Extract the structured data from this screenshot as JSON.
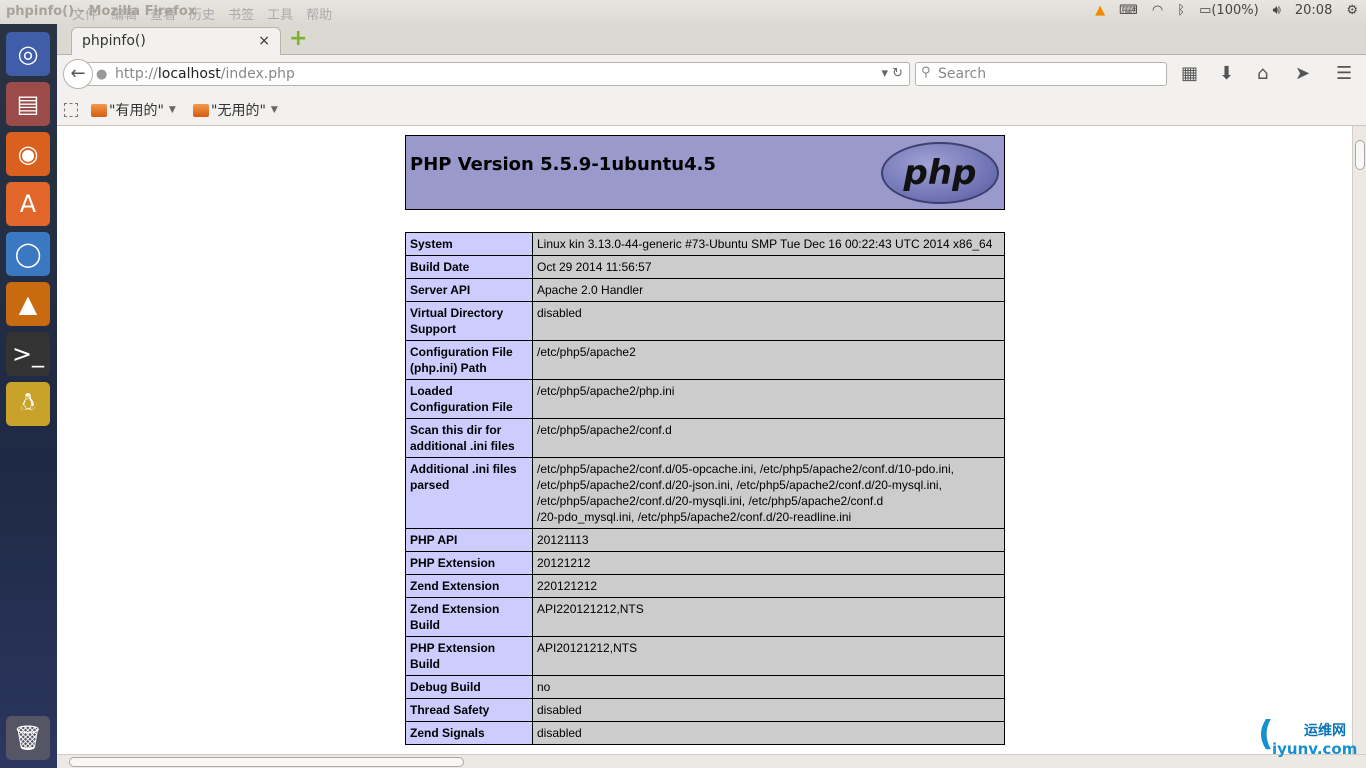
{
  "panel": {
    "window_title": "phpinfo() - Mozilla Firefox",
    "menus": [
      "文件",
      "编辑",
      "查看",
      "历史",
      "书签",
      "工具",
      "帮助"
    ],
    "battery": "(100%)",
    "clock": "20:08"
  },
  "tab": {
    "title": "phpinfo()",
    "close": "×",
    "new_tab": "+"
  },
  "nav": {
    "url_scheme": "http://",
    "url_host": "localhost",
    "url_path": "/index.php",
    "search_placeholder": "Search"
  },
  "bookmarks": [
    {
      "label": "\"有用的\""
    },
    {
      "label": "\"无用的\""
    }
  ],
  "page": {
    "heading": "PHP Version 5.5.9-1ubuntu4.5",
    "logo_text": "php",
    "rows": [
      {
        "k": "System",
        "v": "Linux kin 3.13.0-44-generic #73-Ubuntu SMP Tue Dec 16 00:22:43 UTC 2014 x86_64"
      },
      {
        "k": "Build Date",
        "v": "Oct 29 2014 11:56:57"
      },
      {
        "k": "Server API",
        "v": "Apache 2.0 Handler"
      },
      {
        "k": "Virtual Directory\nSupport",
        "v": "disabled"
      },
      {
        "k": "Configuration File\n(php.ini) Path",
        "v": "/etc/php5/apache2"
      },
      {
        "k": "Loaded\nConfiguration File",
        "v": "/etc/php5/apache2/php.ini"
      },
      {
        "k": "Scan this dir for\nadditional .ini files",
        "v": "/etc/php5/apache2/conf.d"
      },
      {
        "k": "Additional .ini files\nparsed",
        "v": "/etc/php5/apache2/conf.d/05-opcache.ini, /etc/php5/apache2/conf.d/10-pdo.ini,\n/etc/php5/apache2/conf.d/20-json.ini, /etc/php5/apache2/conf.d/20-mysql.ini,\n/etc/php5/apache2/conf.d/20-mysqli.ini, /etc/php5/apache2/conf.d\n/20-pdo_mysql.ini, /etc/php5/apache2/conf.d/20-readline.ini"
      },
      {
        "k": "PHP API",
        "v": "20121113"
      },
      {
        "k": "PHP Extension",
        "v": "20121212"
      },
      {
        "k": "Zend Extension",
        "v": "220121212"
      },
      {
        "k": "Zend Extension\nBuild",
        "v": "API220121212,NTS"
      },
      {
        "k": "PHP Extension\nBuild",
        "v": "API20121212,NTS"
      },
      {
        "k": "Debug Build",
        "v": "no"
      },
      {
        "k": "Thread Safety",
        "v": "disabled"
      },
      {
        "k": "Zend Signals",
        "v": "disabled"
      }
    ]
  },
  "watermark": {
    "cn": "运维网",
    "en": "iyunv.com"
  }
}
